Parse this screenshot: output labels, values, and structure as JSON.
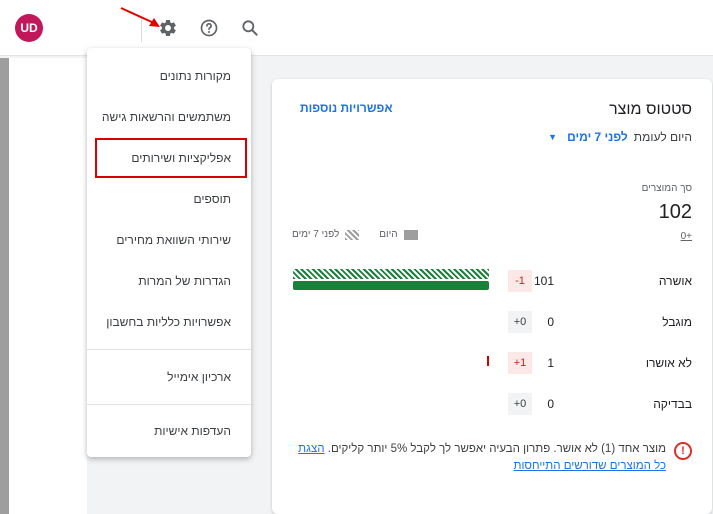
{
  "topbar": {
    "avatar_initials": "UD",
    "icons": [
      "settings-gear-icon",
      "help-circle-icon",
      "search-icon"
    ]
  },
  "settings_menu": {
    "items": [
      "מקורות נתונים",
      "משתמשים והרשאות גישה",
      "אפליקציות ושירותים",
      "תוספים",
      "שירותי השוואת מחירים",
      "הגדרות של המרות",
      "אפשרויות כלליות בחשבון",
      "ארכיון אימייל",
      "העדפות אישיות"
    ],
    "highlighted_index": 2
  },
  "status_card": {
    "title": "סטטוס מוצר",
    "more_options_link": "אפשרויות נוספות",
    "compare_label": "היום לעומת",
    "compare_value": "לפני 7 ימים",
    "total_label": "סך המוצרים",
    "total_value": "102",
    "total_delta": "+0",
    "legend_today": "היום",
    "legend_7days": "לפני 7 ימים",
    "rows": [
      {
        "label": "אושרה",
        "count": "101",
        "change": "-1",
        "bar_fraction": 0.99
      },
      {
        "label": "מוגבל",
        "count": "0",
        "change": "+0"
      },
      {
        "label": "לא אושרו",
        "count": "1",
        "change": "+1"
      },
      {
        "label": "בבדיקה",
        "count": "0",
        "change": "+0"
      }
    ],
    "warning_text": "מוצר אחד (1) לא אושר. פתרון הבעיה יאפשר לך לקבל 5% יותר קליקים.",
    "warning_link": "הצגת כל המוצרים שדורשים התייחסות"
  },
  "colors": {
    "accent": "#1a73e8",
    "approved_green": "#188038",
    "error_red": "#d93025",
    "avatar": "#c2185b"
  }
}
